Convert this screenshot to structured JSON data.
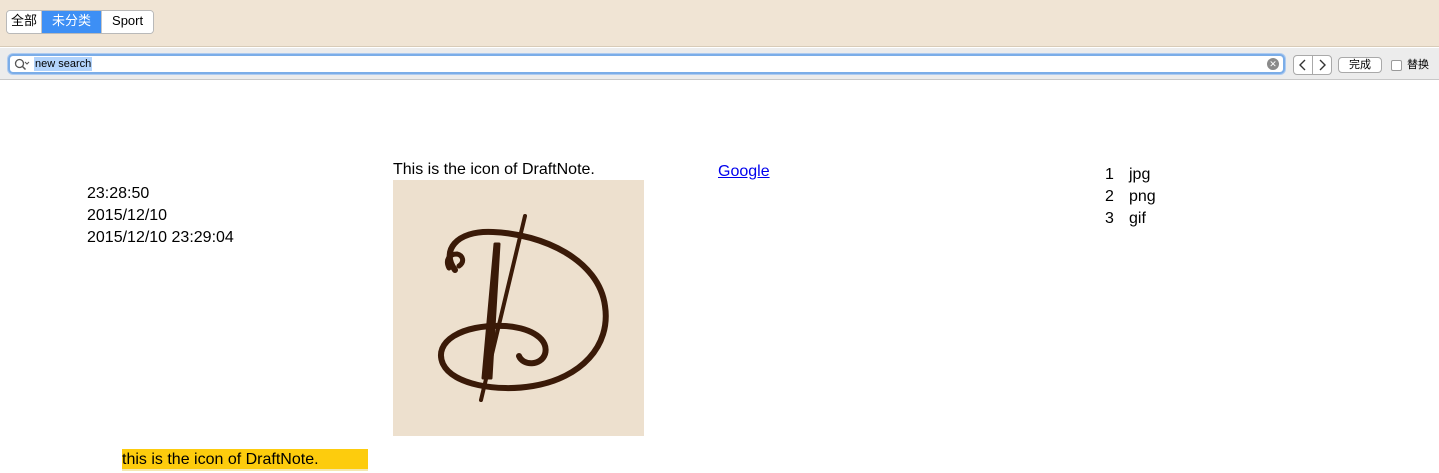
{
  "categories": {
    "all": "全部",
    "uncategorized": "未分类",
    "sport": "Sport"
  },
  "find_bar": {
    "search_value": "new search",
    "done_label": "完成",
    "replace_label": "替换",
    "replace_checked": false
  },
  "content": {
    "time": "23:28:50",
    "date": "2015/12/10",
    "datetime": "2015/12/10 23:29:04",
    "image_caption": "This is the icon of DraftNote.",
    "link_text": "Google",
    "file_types": [
      {
        "num": "1",
        "label": "jpg"
      },
      {
        "num": "2",
        "label": "png"
      },
      {
        "num": "3",
        "label": "gif"
      }
    ],
    "highlight_text": "this is the icon of DraftNote."
  },
  "icons": {
    "search": "search-icon",
    "clear": "clear-icon",
    "prev": "chevron-left-icon",
    "next": "chevron-right-icon"
  },
  "colors": {
    "top_bar": "#f0e4d4",
    "active_segment": "#3d8ff5",
    "highlight": "#fdcc0d",
    "logo_background": "#ede0ce",
    "logo_ink": "#3a1a08",
    "link": "#0000ee"
  }
}
